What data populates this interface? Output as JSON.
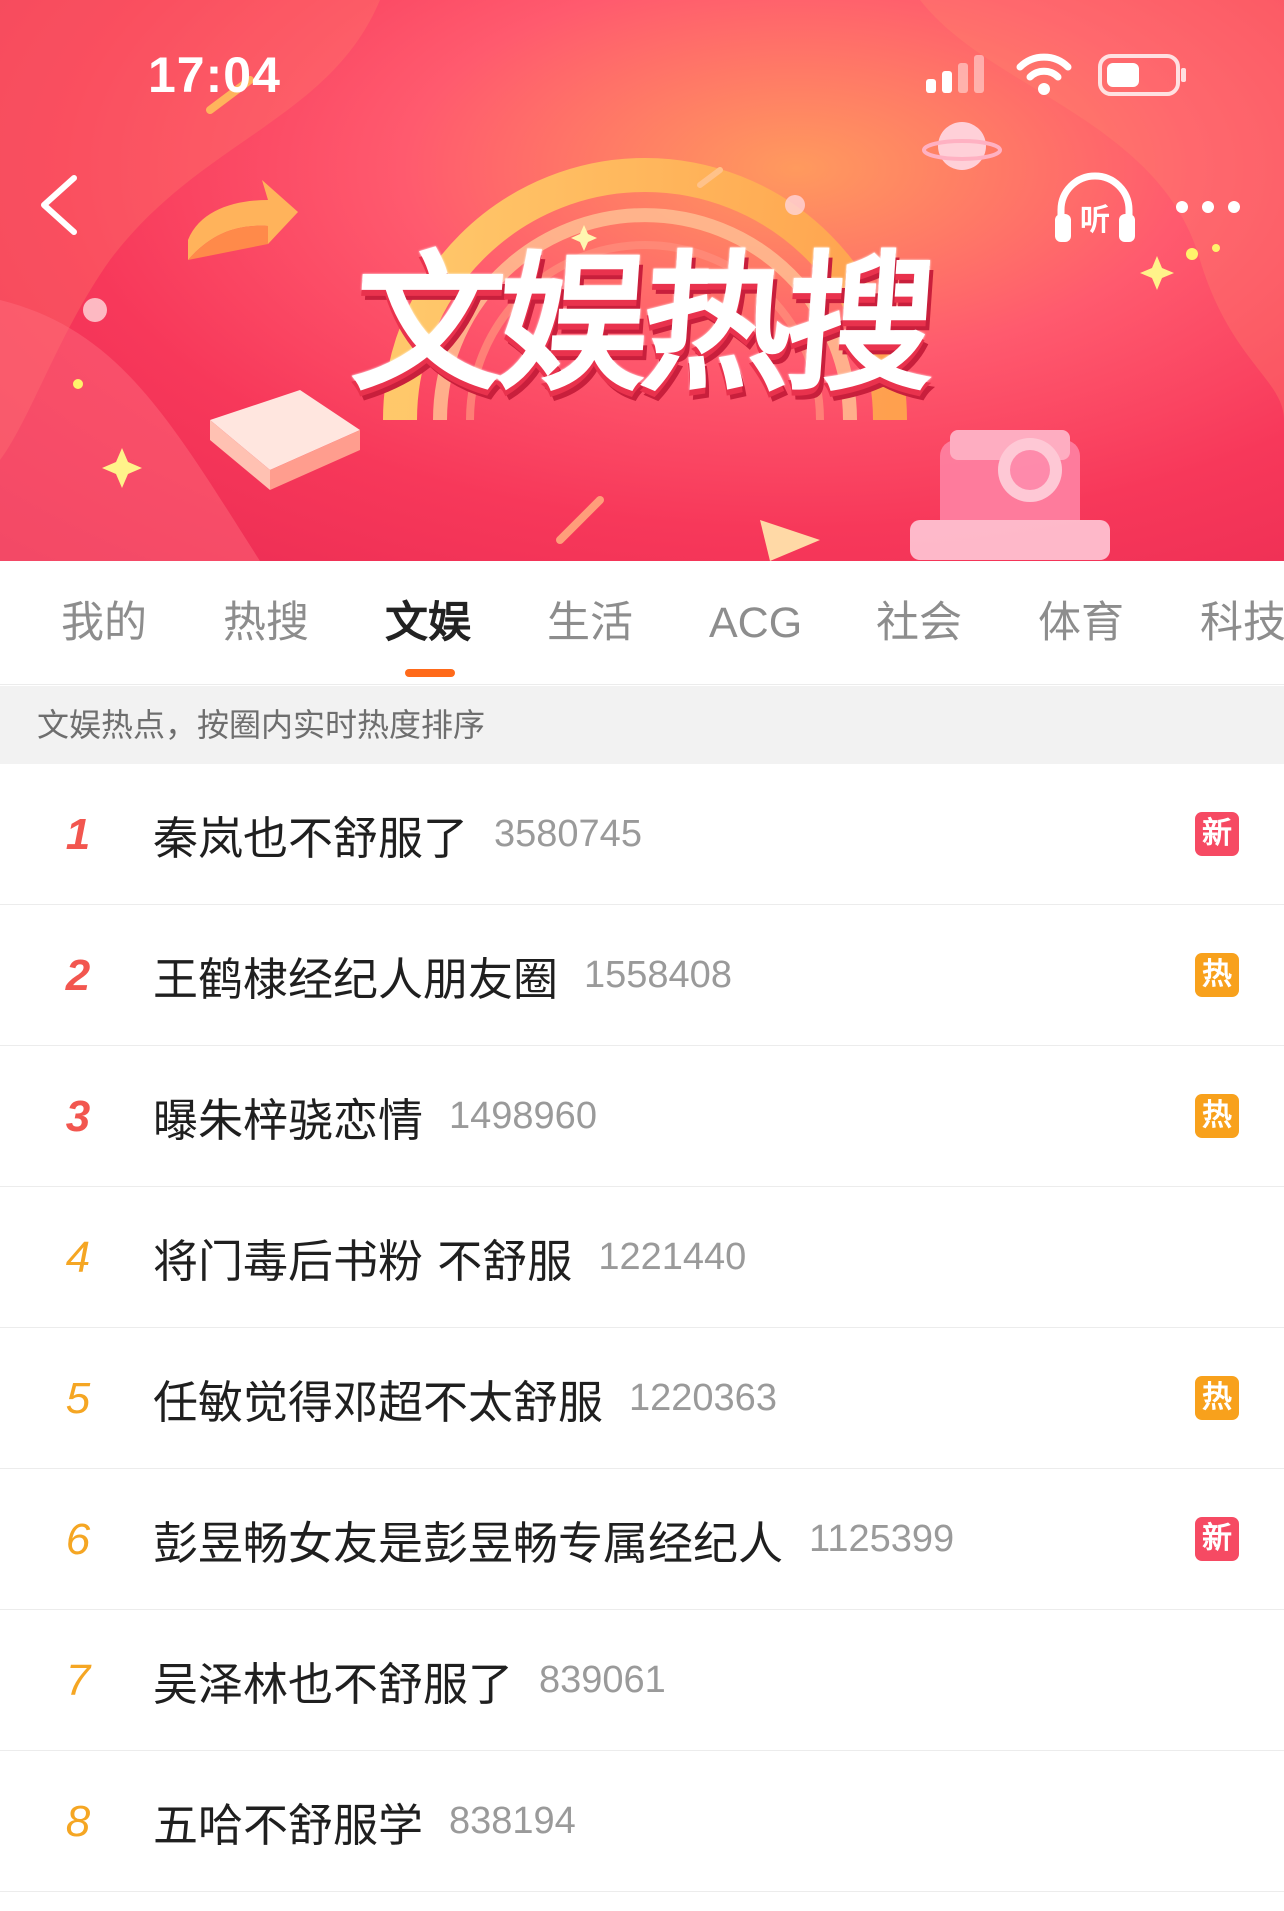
{
  "status_bar": {
    "time": "17:04"
  },
  "banner": {
    "title": "文娱热搜",
    "listen_label": "听"
  },
  "tabs": [
    {
      "label": "我的"
    },
    {
      "label": "热搜"
    },
    {
      "label": "文娱"
    },
    {
      "label": "生活"
    },
    {
      "label": "ACG"
    },
    {
      "label": "社会"
    },
    {
      "label": "体育"
    },
    {
      "label": "科技"
    }
  ],
  "active_tab": "文娱",
  "subheader": {
    "text": "文娱热点，按圈内实时热度排序"
  },
  "colors": {
    "accent": "#ff6a1a",
    "badge_new": "#f64a63",
    "badge_hot": "#f8a11c",
    "rank_top": "#f2564f",
    "rank_other": "#f5a623"
  },
  "list": [
    {
      "rank": "1",
      "title": "秦岚也不舒服了",
      "count": "3580745",
      "badge": "新",
      "badge_type": "new"
    },
    {
      "rank": "2",
      "title": "王鹤棣经纪人朋友圈",
      "count": "1558408",
      "badge": "热",
      "badge_type": "hot"
    },
    {
      "rank": "3",
      "title": "曝朱梓骁恋情",
      "count": "1498960",
      "badge": "热",
      "badge_type": "hot"
    },
    {
      "rank": "4",
      "title": "将门毒后书粉 不舒服",
      "count": "1221440",
      "badge": "",
      "badge_type": ""
    },
    {
      "rank": "5",
      "title": "任敏觉得邓超不太舒服",
      "count": "1220363",
      "badge": "热",
      "badge_type": "hot"
    },
    {
      "rank": "6",
      "title": "彭昱畅女友是彭昱畅专属经纪人",
      "count": "1125399",
      "badge": "新",
      "badge_type": "new"
    },
    {
      "rank": "7",
      "title": "吴泽林也不舒服了",
      "count": "839061",
      "badge": "",
      "badge_type": ""
    },
    {
      "rank": "8",
      "title": "五哈不舒服学",
      "count": "838194",
      "badge": "",
      "badge_type": ""
    }
  ]
}
